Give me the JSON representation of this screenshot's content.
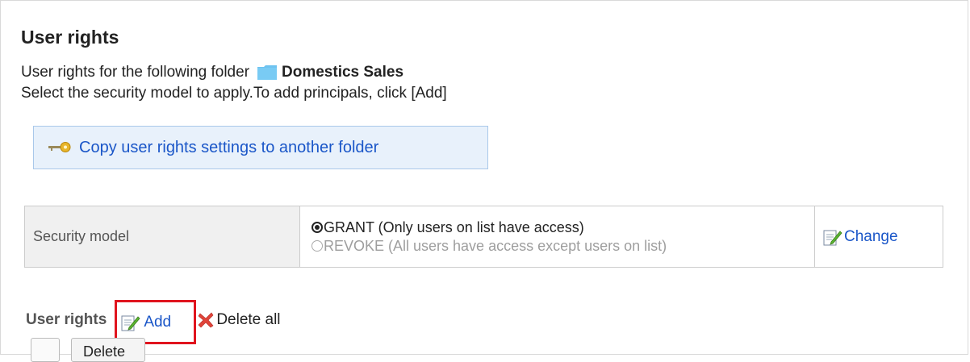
{
  "page": {
    "title": "User rights",
    "description_prefix": "User rights for the following folder",
    "folder_name": "Domestics Sales",
    "instruction": "Select the security model to apply.To add principals, click [Add]"
  },
  "copy_button": {
    "label": "Copy user rights settings to another folder",
    "icon": "key-icon"
  },
  "security_model": {
    "label": "Security model",
    "options": [
      {
        "label": "GRANT (Only users on list have access)",
        "selected": true
      },
      {
        "label": "REVOKE (All users have access except users on list)",
        "selected": false
      }
    ],
    "change_label": "Change"
  },
  "user_rights_bar": {
    "label": "User rights",
    "add_label": "Add",
    "delete_all_label": "Delete all"
  },
  "bottom": {
    "button_label": "Delete"
  },
  "colors": {
    "link": "#1a56c8",
    "highlight_border": "#e0141e",
    "button_bg": "#e8f1fb",
    "label_cell_bg": "#f0f0f0"
  }
}
